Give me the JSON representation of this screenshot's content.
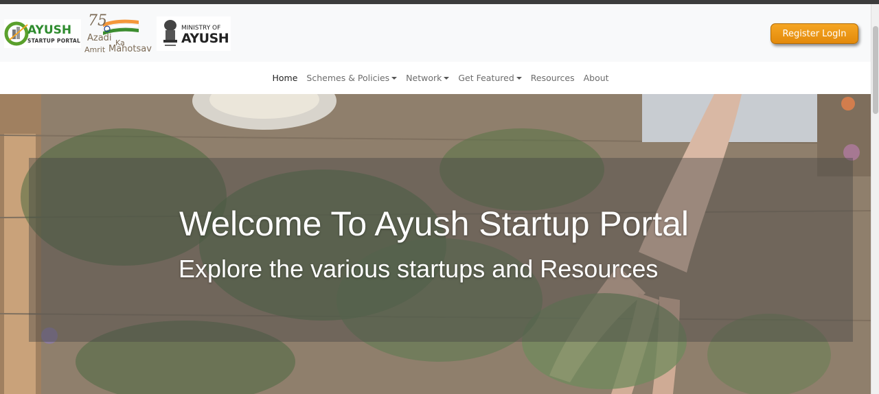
{
  "header": {
    "logos": {
      "ayush_startup": {
        "word": "AYUSH",
        "tag": "STARTUP PORTAL"
      },
      "azadi": {
        "number": "75",
        "line1": "Azadi",
        "line2": "Ka",
        "line3": "Amrit",
        "line4": "Mahotsav"
      },
      "ministry": {
        "line1": "MINISTRY OF",
        "line2": "AYUSH"
      }
    },
    "register_label": "Register LogIn"
  },
  "nav": {
    "items": [
      {
        "label": "Home",
        "dropdown": false,
        "active": true
      },
      {
        "label": "Schemes & Policies",
        "dropdown": true,
        "active": false
      },
      {
        "label": "Network",
        "dropdown": true,
        "active": false
      },
      {
        "label": "Get Featured",
        "dropdown": true,
        "active": false
      },
      {
        "label": "Resources",
        "dropdown": false,
        "active": false
      },
      {
        "label": "About",
        "dropdown": false,
        "active": false
      }
    ]
  },
  "hero": {
    "title": "Welcome To Ayush Startup Portal",
    "subtitle": "Explore the various startups and Resources"
  },
  "colors": {
    "accent": "#f29d1c",
    "nav_bg": "#ffffff",
    "header_bg": "#f8f9fa"
  }
}
